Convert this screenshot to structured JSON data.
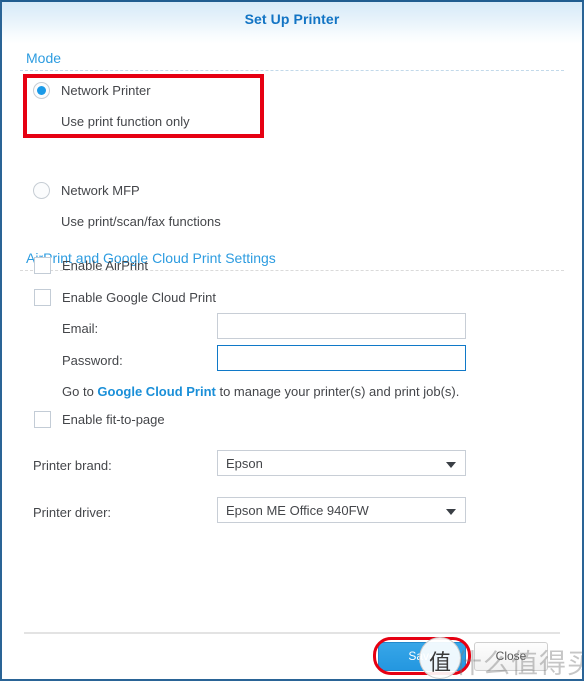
{
  "window": {
    "title": "Set Up Printer"
  },
  "mode_section": {
    "heading": "Mode",
    "options": [
      {
        "label": "Network Printer",
        "description": "Use print function only",
        "selected": true
      },
      {
        "label": "Network MFP",
        "description": "Use print/scan/fax functions",
        "selected": false
      }
    ]
  },
  "airprint_section": {
    "heading": "AirPrint and Google Cloud Print Settings",
    "checkboxes": [
      {
        "label": "Enable AirPrint",
        "checked": false
      },
      {
        "label": "Enable Google Cloud Print",
        "checked": false
      },
      {
        "label": "Enable fit-to-page",
        "checked": false
      }
    ],
    "fields": [
      {
        "label": "Email:",
        "value": "",
        "placeholder": "",
        "focused": false
      },
      {
        "label": "Password:",
        "value": "",
        "placeholder": "",
        "focused": true
      }
    ],
    "link_row": {
      "prefix": "Go to ",
      "link_text": "Google Cloud Print",
      "suffix": " to manage your printer(s) and print job(s)."
    }
  },
  "printer_section": {
    "brand": {
      "label": "Printer brand:",
      "value": "Epson",
      "icon": "chevron-down-icon"
    },
    "driver": {
      "label": "Printer driver:",
      "value": "Epson ME Office 940FW",
      "icon": "chevron-down-icon"
    }
  },
  "footer": {
    "save_label": "Save",
    "close_label": "Close"
  },
  "watermark": {
    "badge_char": "值",
    "text": "什么值得买"
  },
  "colors": {
    "title_blue": "#1274c4",
    "section_blue": "#2d9ce0",
    "link_blue": "#1a8fd8",
    "radio_fill": "#1a9ae8",
    "focus_border": "#1079c8",
    "annotation_red": "#e60012",
    "primary_button": "#2497e0",
    "window_border": "#2a6496"
  }
}
